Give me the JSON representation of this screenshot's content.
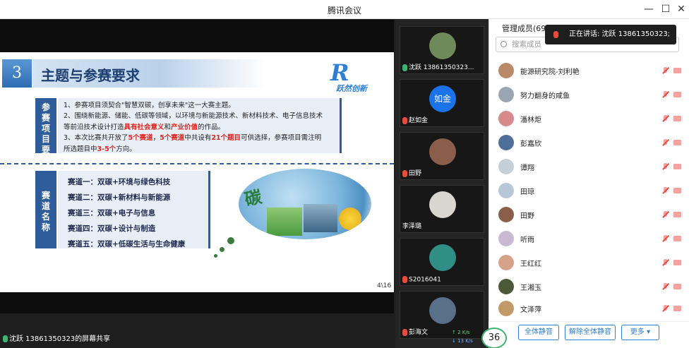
{
  "window": {
    "title": "腾讯会议"
  },
  "slide": {
    "number": "3",
    "title": "主题与参赛要求",
    "logo_text": "跃然创新",
    "req_label": "参赛项目要求",
    "req_lines": [
      "1、参赛项目须契合\"智慧双碳，创享未来\"这一大赛主题。",
      "2、围绕新能源、储能、低碳等领域，以环境与新能源技术、新材料技术、电子信息技术",
      "等前沿技术设计打造具有社会意义和产业价值的作品。",
      "3、本次比赛共开放了5个赛道，5个赛道中共设有21个题目可供选择，参赛项目需注明",
      "所选题目中3-5个方向。"
    ],
    "track_label": "赛道名称",
    "tracks": [
      "赛道一：双碳+环境与绿色科技",
      "赛道二：双碳+新材料与新能源",
      "赛道三：双碳+电子与信息",
      "赛道四：双碳+设计与制造",
      "赛道五：双碳+低碳生活与生命健康"
    ],
    "collage_char": "碳",
    "page": "4\\16"
  },
  "share_label": "沈跃 13861350323的屏幕共享",
  "tiles": [
    {
      "name": "沈跃 13861350323...",
      "avatar_color": "#6f8a5a"
    },
    {
      "name": "赵如金",
      "avatar_text": "如金",
      "avatar_color": "#1a73e8"
    },
    {
      "name": "田野",
      "avatar_color": "#8a5e4a"
    },
    {
      "name": "李泽璐",
      "avatar_color": "#d9d5cf"
    },
    {
      "name": "S2016041",
      "avatar_color": "#2f8f87"
    },
    {
      "name": "彭海文",
      "avatar_color": "#5a6f8a"
    }
  ],
  "panel": {
    "title": "管理成员(69)",
    "search_placeholder": "搜索成员",
    "speaking": "正在讲话: 沈跃 13861350323;",
    "members": [
      {
        "name": "能源研究院-刘利艳",
        "color": "#b88a6a"
      },
      {
        "name": "努力翻身的咸鱼",
        "color": "#9aa6b2"
      },
      {
        "name": "潘林炬",
        "color": "#d78a8a"
      },
      {
        "name": "彭嘉欣",
        "color": "#4d6f9a"
      },
      {
        "name": "谭翔",
        "color": "#c7cfd6"
      },
      {
        "name": "田琼",
        "color": "#b6c7d8"
      },
      {
        "name": "田野",
        "color": "#8a5e4a"
      },
      {
        "name": "听雨",
        "color": "#c9b9d3"
      },
      {
        "name": "王红红",
        "color": "#d6a38a"
      },
      {
        "name": "王湘玉",
        "color": "#4d5a3a"
      },
      {
        "name": "文泽萍",
        "color": "#c29a6a"
      }
    ],
    "buttons": {
      "mute_all": "全体静音",
      "unmute_all": "解除全体静音",
      "more": "更多 ▾"
    }
  },
  "network": {
    "up": "2 K/s",
    "down": "13 K/s",
    "quality": "36"
  }
}
